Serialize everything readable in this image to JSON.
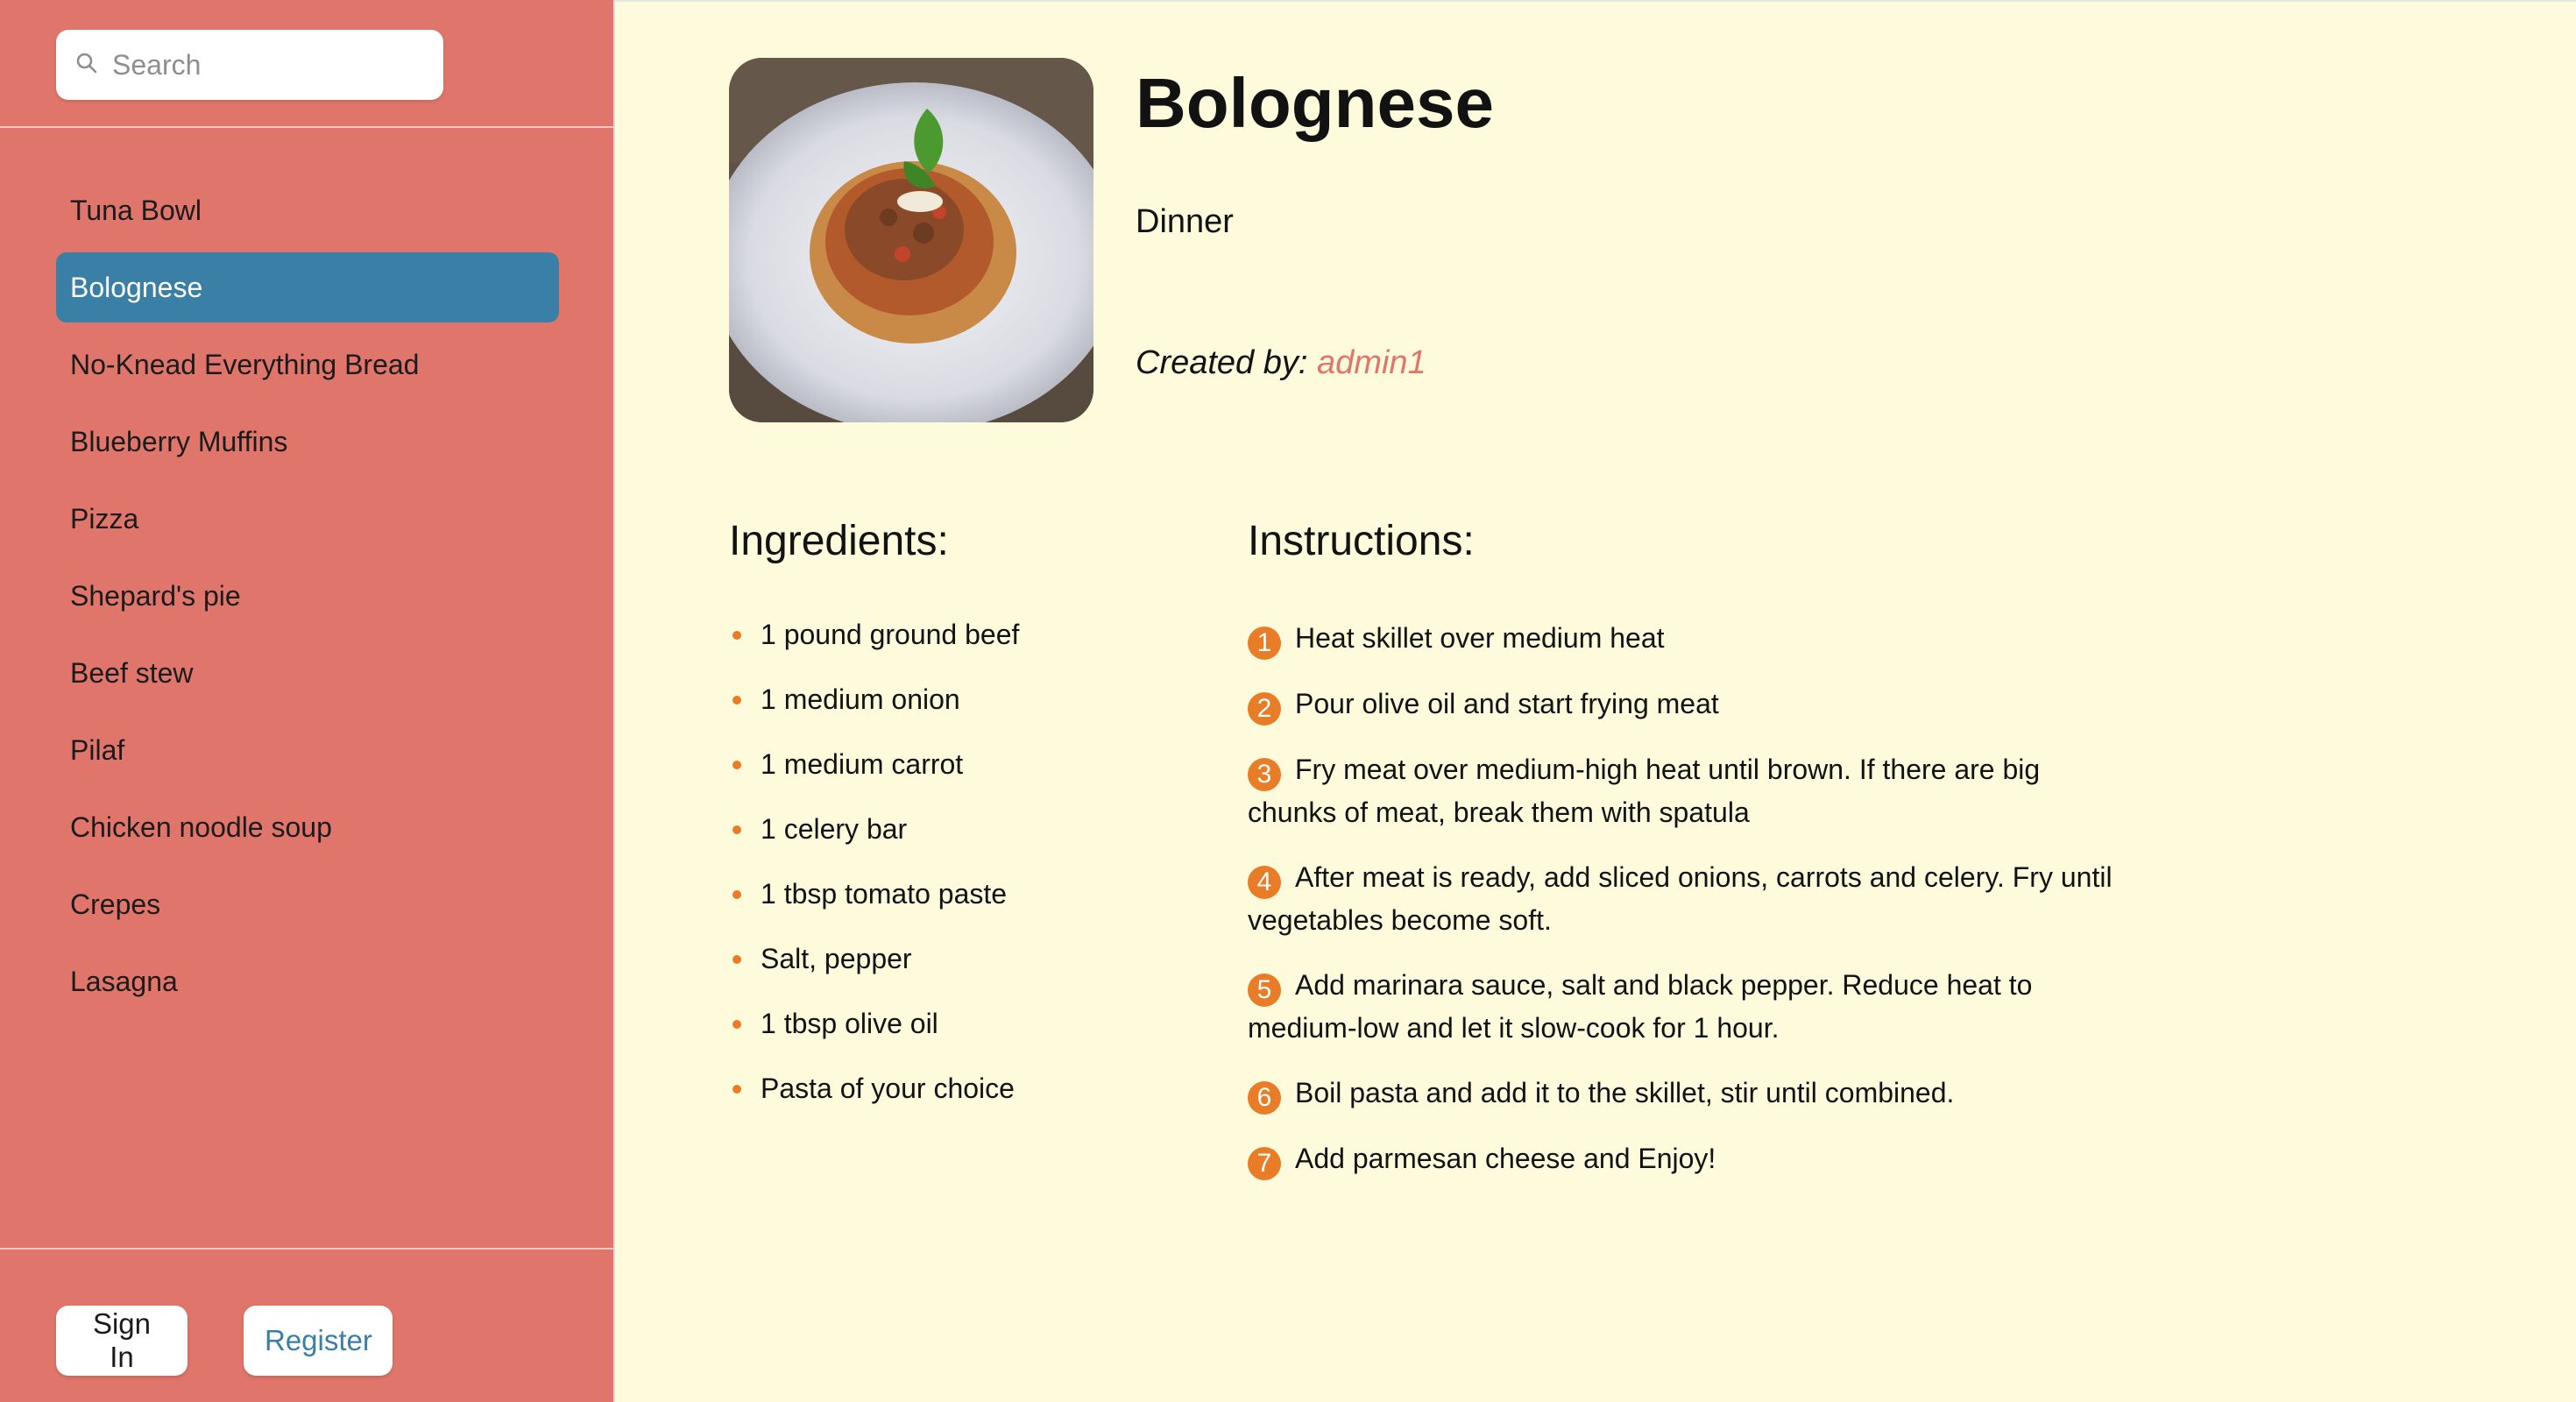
{
  "sidebar": {
    "search": {
      "placeholder": "Search",
      "value": ""
    },
    "recipes": [
      {
        "label": "Tuna Bowl",
        "active": false
      },
      {
        "label": "Bolognese",
        "active": true
      },
      {
        "label": "No-Knead Everything Bread",
        "active": false
      },
      {
        "label": "Blueberry Muffins",
        "active": false
      },
      {
        "label": "Pizza",
        "active": false
      },
      {
        "label": "Shepard's pie",
        "active": false
      },
      {
        "label": "Beef stew",
        "active": false
      },
      {
        "label": "Pilaf",
        "active": false
      },
      {
        "label": "Chicken noodle soup",
        "active": false
      },
      {
        "label": "Crepes",
        "active": false
      },
      {
        "label": "Lasagna",
        "active": false
      }
    ],
    "auth": {
      "sign_in": "Sign In",
      "register": "Register"
    }
  },
  "recipe": {
    "title": "Bolognese",
    "category": "Dinner",
    "created_by_label": "Created by:",
    "author": "admin1",
    "ingredients_title": "Ingredients:",
    "ingredients": [
      "1 pound ground beef",
      "1 medium onion",
      "1 medium carrot",
      "1 celery bar",
      "1 tbsp tomato paste",
      "Salt, pepper",
      "1 tbsp olive oil",
      "Pasta of your choice"
    ],
    "instructions_title": "Instructions:",
    "instructions": [
      "Heat skillet over medium heat",
      "Pour olive oil and start frying meat",
      "Fry meat over medium-high heat until brown. If there are big chunks of meat, break them with spatula",
      "After meat is ready, add sliced onions, carrots and celery. Fry until vegetables become soft.",
      "Add marinara sauce, salt and black pepper. Reduce heat to medium-low and let it slow-cook for 1 hour.",
      "Boil pasta and add it to the skillet, stir until combined.",
      "Add parmesan cheese and Enjoy!"
    ]
  },
  "colors": {
    "sidebar_bg": "#e0766b",
    "main_bg": "#fdfbdc",
    "accent_blue": "#3a7fa6",
    "accent_orange": "#e87c27"
  },
  "icons": {
    "search": "search-icon"
  }
}
